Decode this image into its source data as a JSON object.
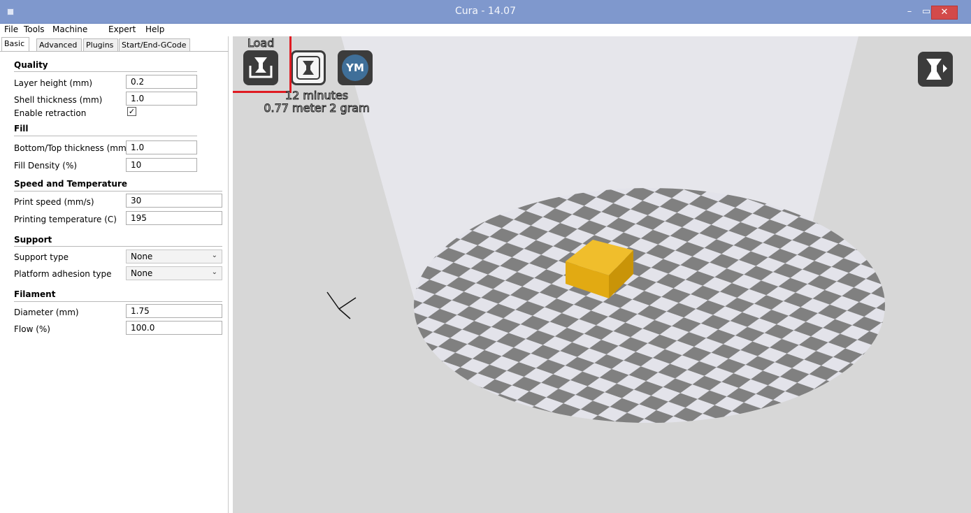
{
  "window": {
    "title": "Cura - 14.07",
    "minimize": "–",
    "maximize": "▭",
    "close": "✕"
  },
  "menu": [
    "File",
    "Tools",
    "Machine",
    "Expert",
    "Help"
  ],
  "tabs": [
    "Basic",
    "Advanced",
    "Plugins",
    "Start/End-GCode"
  ],
  "active_tab": "Basic",
  "quality": {
    "title": "Quality",
    "layer_height_label": "Layer height (mm)",
    "layer_height": "0.2",
    "shell_thickness_label": "Shell thickness (mm)",
    "shell_thickness": "1.0",
    "enable_retraction_label": "Enable retraction",
    "enable_retraction_mark": "✓"
  },
  "fill": {
    "title": "Fill",
    "bottom_top_label": "Bottom/Top thickness (mm)",
    "bottom_top": "1.0",
    "density_label": "Fill Density (%)",
    "density": "10"
  },
  "speed": {
    "title": "Speed and Temperature",
    "print_speed_label": "Print speed (mm/s)",
    "print_speed": "30",
    "temp_label": "Printing temperature (C)",
    "temp": "195"
  },
  "support": {
    "title": "Support",
    "type_label": "Support type",
    "type": "None",
    "adhesion_label": "Platform adhesion type",
    "adhesion": "None"
  },
  "filament": {
    "title": "Filament",
    "diameter_label": "Diameter (mm)",
    "diameter": "1.75",
    "flow_label": "Flow (%)",
    "flow": "100.0"
  },
  "viewport": {
    "load_label": "Load",
    "ym_label": "YM",
    "time": "12 minutes",
    "material": "0.77 meter 2 gram",
    "colors": {
      "background": "#d7d7d7",
      "light_cone": "#e6e6eb",
      "bed_light": "#e3e3ea",
      "bed_dark": "#808080",
      "model_top": "#f0be2c",
      "model_front": "#e2aa12",
      "model_side": "#c99408",
      "highlight": "#e01b22"
    }
  }
}
